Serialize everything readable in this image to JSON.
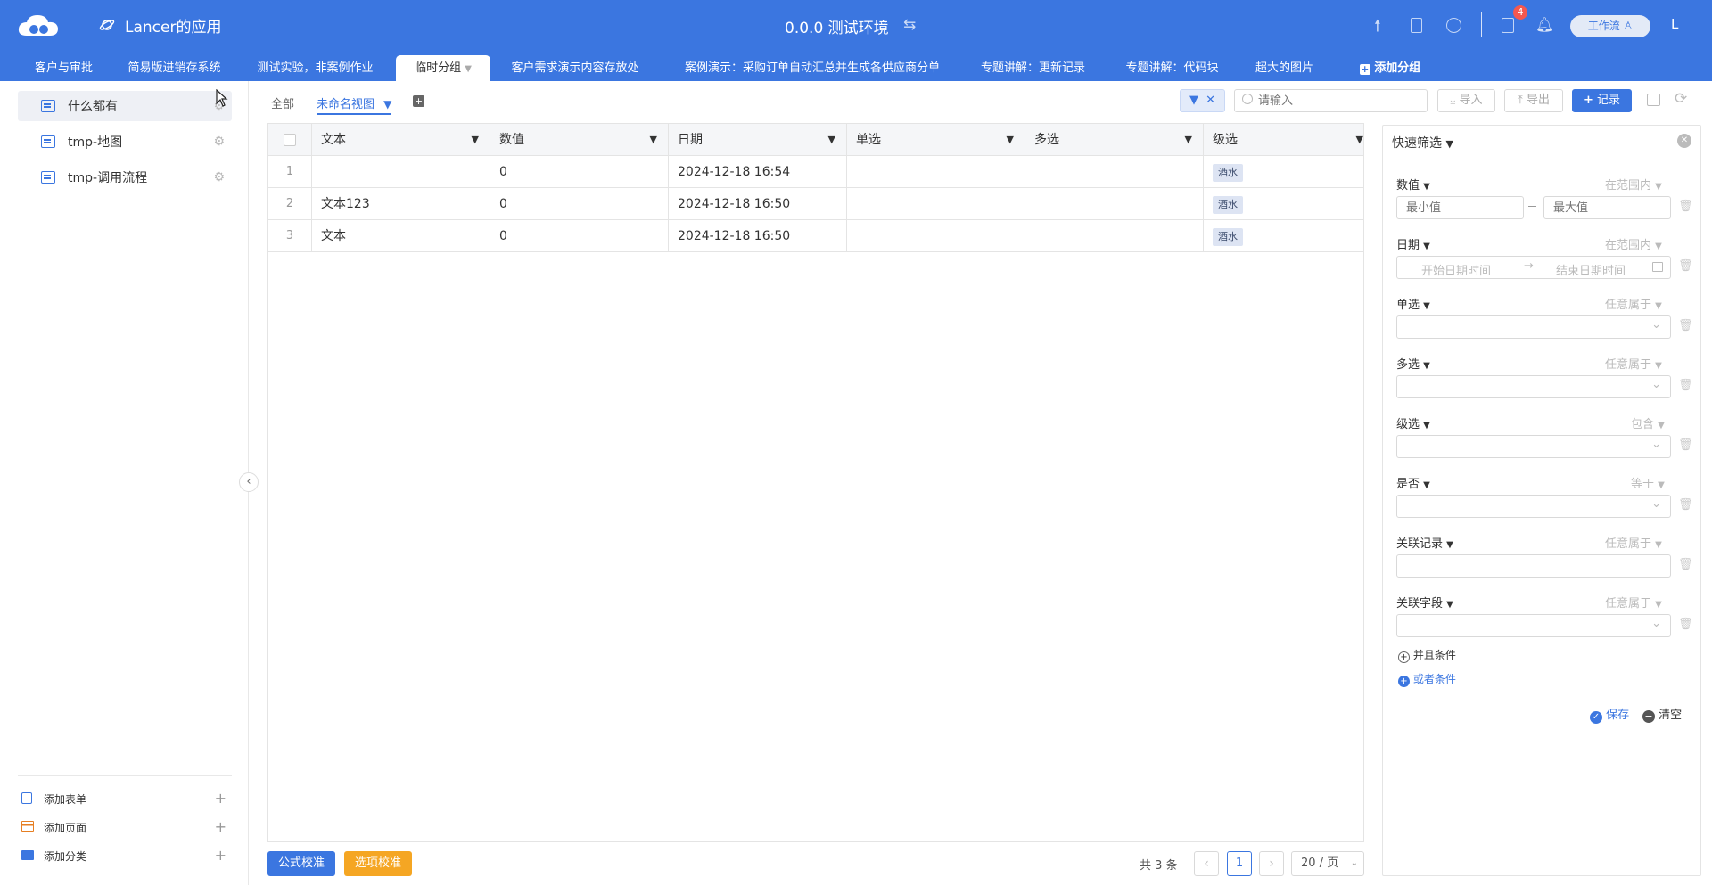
{
  "header": {
    "app_name": "Lancer的应用",
    "env_title": "0.0.0 测试环境",
    "notification_count": "4",
    "workflow_label": "工作流",
    "user_initial": "L"
  },
  "tabs": [
    {
      "label": "客户与审批"
    },
    {
      "label": "简易版进销存系统"
    },
    {
      "label": "测试实验，非案例作业"
    },
    {
      "label": "临时分组"
    },
    {
      "label": "客户需求演示内容存放处"
    },
    {
      "label": "案例演示：采购订单自动汇总并生成各供应商分单"
    },
    {
      "label": "专题讲解：更新记录"
    },
    {
      "label": "专题讲解：代码块"
    },
    {
      "label": "超大的图片"
    },
    {
      "label": "添加分组"
    }
  ],
  "sidebar": {
    "items": [
      {
        "label": "什么都有"
      },
      {
        "label": "tmp-地图"
      },
      {
        "label": "tmp-调用流程"
      }
    ],
    "bottom": [
      {
        "label": "添加表单"
      },
      {
        "label": "添加页面"
      },
      {
        "label": "添加分类"
      }
    ]
  },
  "toolbar": {
    "view_all": "全部",
    "view_current": "未命名视图",
    "search_placeholder": "请输入",
    "import_label": "导入",
    "export_label": "导出",
    "record_label": "记录"
  },
  "table": {
    "columns": [
      "文本",
      "数值",
      "日期",
      "单选",
      "多选",
      "级选"
    ],
    "rows": [
      {
        "no": "1",
        "text": "",
        "num": "0",
        "date": "2024-12-18 16:54",
        "single": "",
        "multi": "",
        "cascade": "酒水"
      },
      {
        "no": "2",
        "text": "文本123",
        "num": "0",
        "date": "2024-12-18 16:50",
        "single": "",
        "multi": "",
        "cascade": "酒水"
      },
      {
        "no": "3",
        "text": "文本",
        "num": "0",
        "date": "2024-12-18 16:50",
        "single": "",
        "multi": "",
        "cascade": "酒水"
      }
    ]
  },
  "footer": {
    "formula_check": "公式校准",
    "option_check": "选项校准",
    "total": "共 3 条",
    "page": "1",
    "page_size": "20 / 页"
  },
  "filter_panel": {
    "title": "快速筛选",
    "fields": [
      {
        "label": "数值",
        "op": "在范围内"
      },
      {
        "label": "日期",
        "op": "在范围内"
      },
      {
        "label": "单选",
        "op": "任意属于"
      },
      {
        "label": "多选",
        "op": "任意属于"
      },
      {
        "label": "级选",
        "op": "包含"
      },
      {
        "label": "是否",
        "op": "等于"
      },
      {
        "label": "关联记录",
        "op": "任意属于"
      },
      {
        "label": "关联字段",
        "op": "任意属于"
      }
    ],
    "min_placeholder": "最小值",
    "max_placeholder": "最大值",
    "start_placeholder": "开始日期时间",
    "end_placeholder": "结束日期时间",
    "and_condition": "并且条件",
    "or_condition": "或者条件",
    "save_label": "保存",
    "clear_label": "清空"
  },
  "colors": {
    "brand": "#3b76e0",
    "orange": "#f5a623",
    "badge": "#f5584f"
  }
}
